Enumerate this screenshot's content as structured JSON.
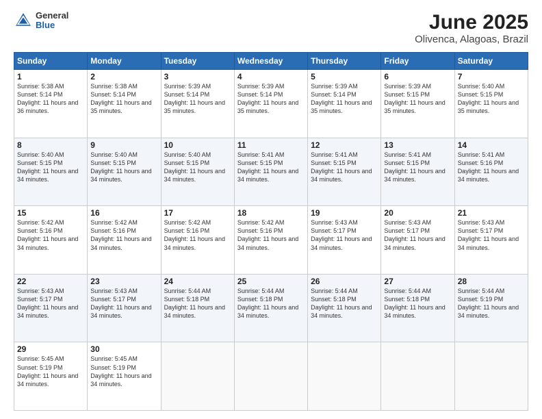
{
  "app": {
    "logo_general": "General",
    "logo_blue": "Blue",
    "title": "June 2025",
    "subtitle": "Olivenca, Alagoas, Brazil"
  },
  "calendar": {
    "headers": [
      "Sunday",
      "Monday",
      "Tuesday",
      "Wednesday",
      "Thursday",
      "Friday",
      "Saturday"
    ],
    "weeks": [
      [
        null,
        {
          "day": "2",
          "sunrise": "5:38 AM",
          "sunset": "5:14 PM",
          "daylight": "11 hours and 35 minutes."
        },
        {
          "day": "3",
          "sunrise": "5:39 AM",
          "sunset": "5:14 PM",
          "daylight": "11 hours and 35 minutes."
        },
        {
          "day": "4",
          "sunrise": "5:39 AM",
          "sunset": "5:14 PM",
          "daylight": "11 hours and 35 minutes."
        },
        {
          "day": "5",
          "sunrise": "5:39 AM",
          "sunset": "5:14 PM",
          "daylight": "11 hours and 35 minutes."
        },
        {
          "day": "6",
          "sunrise": "5:39 AM",
          "sunset": "5:15 PM",
          "daylight": "11 hours and 35 minutes."
        },
        {
          "day": "7",
          "sunrise": "5:40 AM",
          "sunset": "5:15 PM",
          "daylight": "11 hours and 35 minutes."
        }
      ],
      [
        {
          "day": "1",
          "sunrise": "5:38 AM",
          "sunset": "5:14 PM",
          "daylight": "11 hours and 36 minutes."
        },
        {
          "day": "9",
          "sunrise": "5:40 AM",
          "sunset": "5:15 PM",
          "daylight": "11 hours and 34 minutes."
        },
        {
          "day": "10",
          "sunrise": "5:40 AM",
          "sunset": "5:15 PM",
          "daylight": "11 hours and 34 minutes."
        },
        {
          "day": "11",
          "sunrise": "5:41 AM",
          "sunset": "5:15 PM",
          "daylight": "11 hours and 34 minutes."
        },
        {
          "day": "12",
          "sunrise": "5:41 AM",
          "sunset": "5:15 PM",
          "daylight": "11 hours and 34 minutes."
        },
        {
          "day": "13",
          "sunrise": "5:41 AM",
          "sunset": "5:15 PM",
          "daylight": "11 hours and 34 minutes."
        },
        {
          "day": "14",
          "sunrise": "5:41 AM",
          "sunset": "5:16 PM",
          "daylight": "11 hours and 34 minutes."
        }
      ],
      [
        {
          "day": "8",
          "sunrise": "5:40 AM",
          "sunset": "5:15 PM",
          "daylight": "11 hours and 34 minutes."
        },
        {
          "day": "16",
          "sunrise": "5:42 AM",
          "sunset": "5:16 PM",
          "daylight": "11 hours and 34 minutes."
        },
        {
          "day": "17",
          "sunrise": "5:42 AM",
          "sunset": "5:16 PM",
          "daylight": "11 hours and 34 minutes."
        },
        {
          "day": "18",
          "sunrise": "5:42 AM",
          "sunset": "5:16 PM",
          "daylight": "11 hours and 34 minutes."
        },
        {
          "day": "19",
          "sunrise": "5:43 AM",
          "sunset": "5:17 PM",
          "daylight": "11 hours and 34 minutes."
        },
        {
          "day": "20",
          "sunrise": "5:43 AM",
          "sunset": "5:17 PM",
          "daylight": "11 hours and 34 minutes."
        },
        {
          "day": "21",
          "sunrise": "5:43 AM",
          "sunset": "5:17 PM",
          "daylight": "11 hours and 34 minutes."
        }
      ],
      [
        {
          "day": "15",
          "sunrise": "5:42 AM",
          "sunset": "5:16 PM",
          "daylight": "11 hours and 34 minutes."
        },
        {
          "day": "23",
          "sunrise": "5:43 AM",
          "sunset": "5:17 PM",
          "daylight": "11 hours and 34 minutes."
        },
        {
          "day": "24",
          "sunrise": "5:44 AM",
          "sunset": "5:18 PM",
          "daylight": "11 hours and 34 minutes."
        },
        {
          "day": "25",
          "sunrise": "5:44 AM",
          "sunset": "5:18 PM",
          "daylight": "11 hours and 34 minutes."
        },
        {
          "day": "26",
          "sunrise": "5:44 AM",
          "sunset": "5:18 PM",
          "daylight": "11 hours and 34 minutes."
        },
        {
          "day": "27",
          "sunrise": "5:44 AM",
          "sunset": "5:18 PM",
          "daylight": "11 hours and 34 minutes."
        },
        {
          "day": "28",
          "sunrise": "5:44 AM",
          "sunset": "5:19 PM",
          "daylight": "11 hours and 34 minutes."
        }
      ],
      [
        {
          "day": "22",
          "sunrise": "5:43 AM",
          "sunset": "5:17 PM",
          "daylight": "11 hours and 34 minutes."
        },
        {
          "day": "30",
          "sunrise": "5:45 AM",
          "sunset": "5:19 PM",
          "daylight": "11 hours and 34 minutes."
        },
        null,
        null,
        null,
        null,
        null
      ],
      [
        {
          "day": "29",
          "sunrise": "5:45 AM",
          "sunset": "5:19 PM",
          "daylight": "11 hours and 34 minutes."
        },
        null,
        null,
        null,
        null,
        null,
        null
      ]
    ]
  }
}
